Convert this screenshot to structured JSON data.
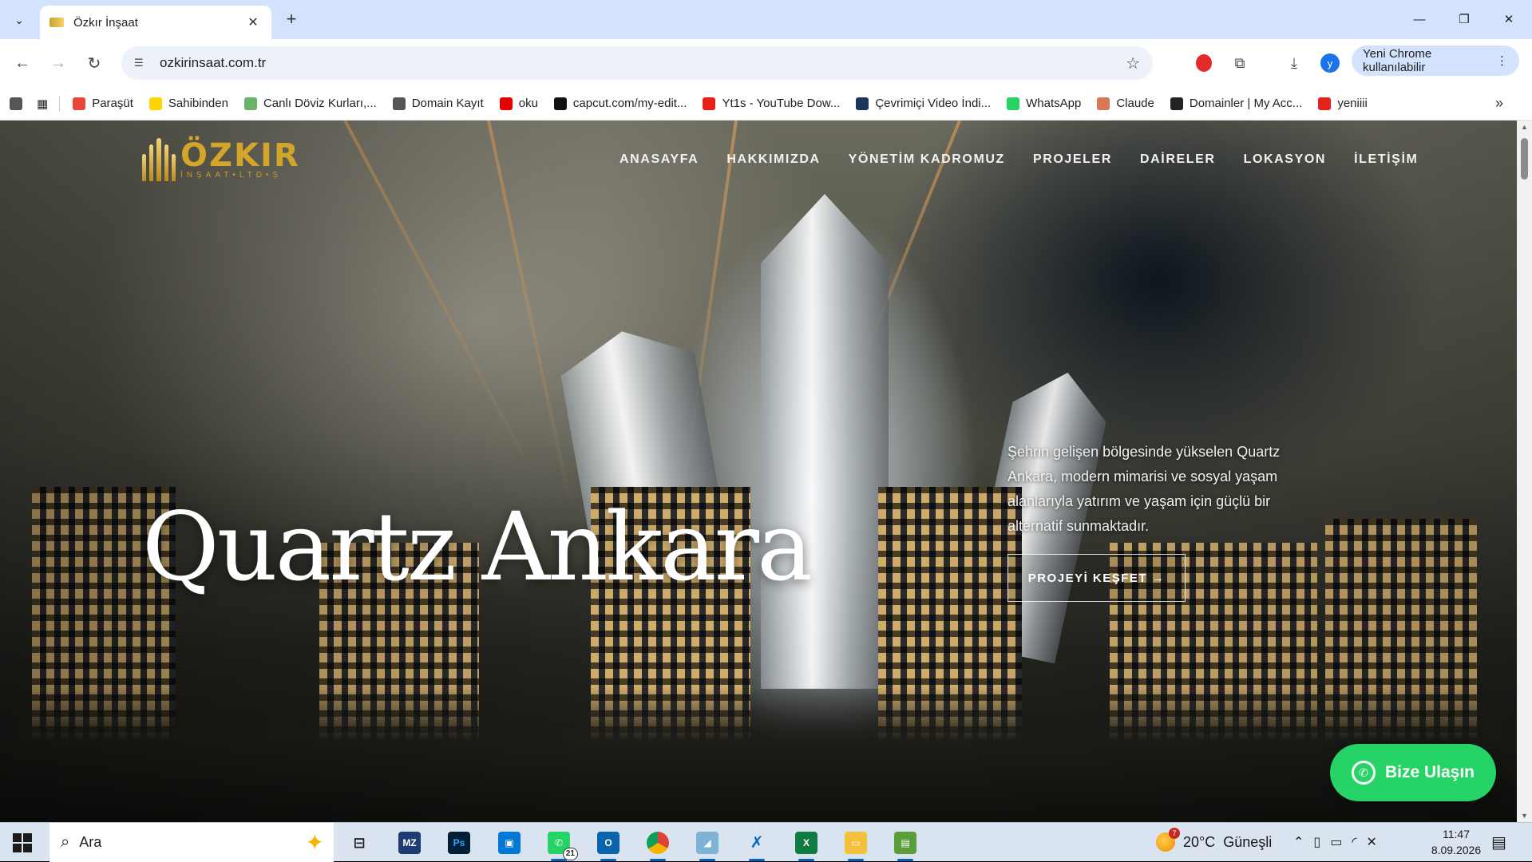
{
  "browser": {
    "tab_title": "Özkır İnşaat",
    "url": "ozkirinsaat.com.tr",
    "update_label": "Yeni Chrome kullanılabilir",
    "profile_initial": "y",
    "bookmarks": [
      {
        "label": "Paraşüt",
        "color": "#e8453c"
      },
      {
        "label": "Sahibinden",
        "color": "#ffd400"
      },
      {
        "label": "Canlı Döviz Kurları,...",
        "color": "#6bb36b"
      },
      {
        "label": "Domain Kayıt",
        "color": "#555555"
      },
      {
        "label": "oku",
        "color": "#e60000"
      },
      {
        "label": "capcut.com/my-edit...",
        "color": "#111111"
      },
      {
        "label": "Yt1s - YouTube Dow...",
        "color": "#e62117"
      },
      {
        "label": "Çevrimiçi Video İndi...",
        "color": "#1d3557"
      },
      {
        "label": "WhatsApp",
        "color": "#25d366"
      },
      {
        "label": "Claude",
        "color": "#d97757"
      },
      {
        "label": "Domainler | My Acc...",
        "color": "#222222"
      },
      {
        "label": "yeniiii",
        "color": "#e62117"
      }
    ]
  },
  "site": {
    "logo_name": "ÖZKIR",
    "logo_sub": "İNŞAAT•LTD•Ş",
    "nav": [
      "ANASAYFA",
      "HAKKIMIZDA",
      "YÖNETİM KADROMUZ",
      "PROJELER",
      "DAİRELER",
      "LOKASYON",
      "İLETİŞİM"
    ],
    "hero_title": "Quartz Ankara",
    "hero_description": "Şehrin gelişen bölgesinde yükselen Quartz Ankara, modern mimarisi ve sosyal yaşam alanlarıyla yatırım ve yaşam için güçlü bir alternatif sunmaktadır.",
    "hero_cta": "PROJEYİ KEŞFET →",
    "whatsapp_button": "Bize Ulaşın"
  },
  "taskbar": {
    "search_placeholder": "Ara",
    "whatsapp_badge": "21",
    "weather_badge": "7",
    "weather": "20°C  Güneşli",
    "time": "11:47",
    "date": "8.09.2026"
  }
}
